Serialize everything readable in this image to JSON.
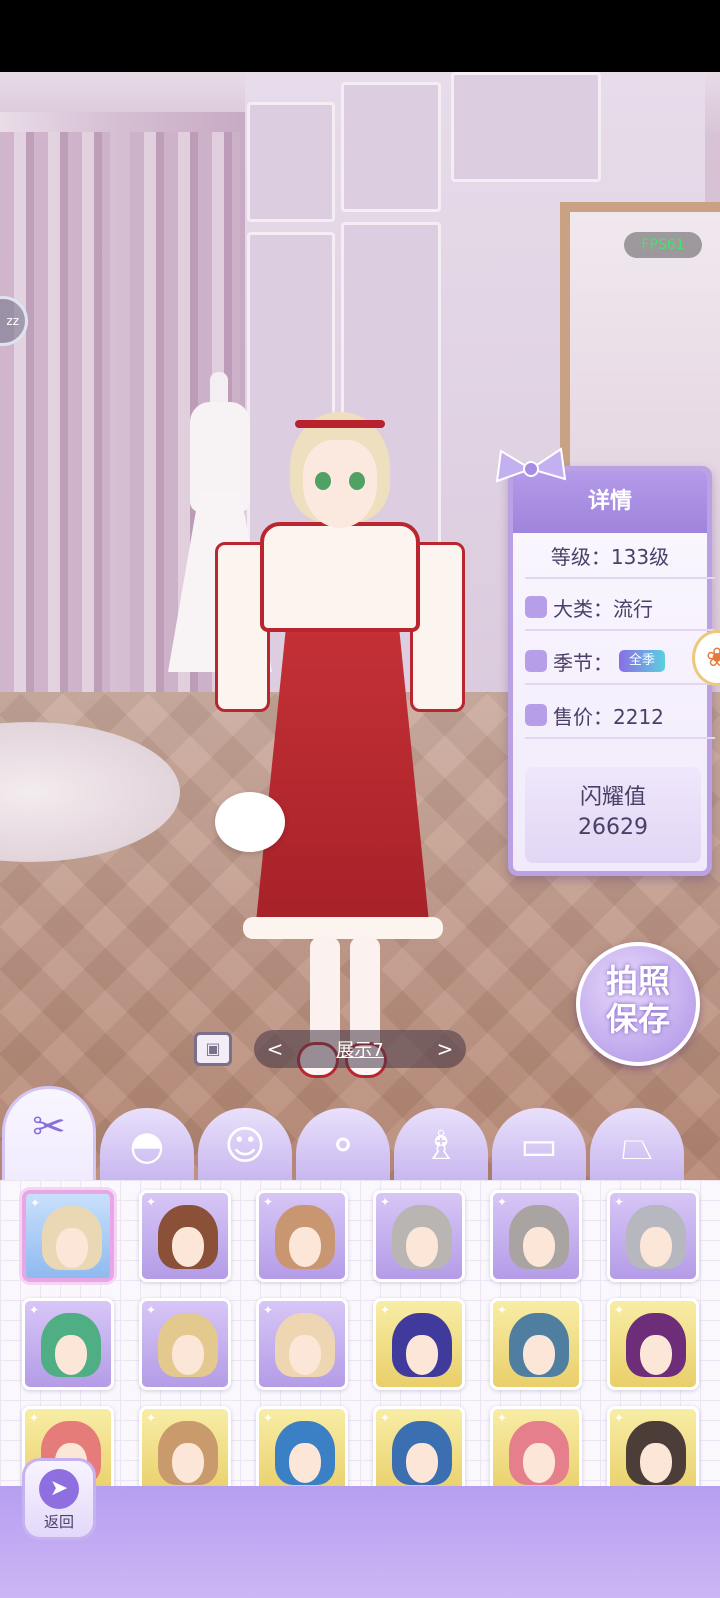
{
  "fps_label": "FPS61",
  "side_bubble": "zz",
  "detail_panel": {
    "title": "详情",
    "level": "等级：133级",
    "category": "大类：流行",
    "season_label": "季节：",
    "season_tag": "全季",
    "price": "售价：2212",
    "shine_label": "闪耀值",
    "shine_value": "26629"
  },
  "photo_button": {
    "line1": "拍照",
    "line2": "保存"
  },
  "outfit_nav": {
    "prev": "<",
    "name": "展示7",
    "next": ">"
  },
  "category_tabs": [
    {
      "icon": "scissors-icon",
      "glyph": "✂",
      "active": true
    },
    {
      "icon": "hat-icon",
      "glyph": "◓",
      "active": false
    },
    {
      "icon": "face-icon",
      "glyph": "☺",
      "active": false
    },
    {
      "icon": "earrings-icon",
      "glyph": "⚬",
      "active": false
    },
    {
      "icon": "dress-icon",
      "glyph": "♗",
      "active": false
    },
    {
      "icon": "shirt-icon",
      "glyph": "▭",
      "active": false
    },
    {
      "icon": "skirt-icon",
      "glyph": "⏢",
      "active": false
    }
  ],
  "hair_items": [
    {
      "rarity": "blue",
      "hair_color": "#ead7b4",
      "selected": true
    },
    {
      "rarity": "purple",
      "hair_color": "#8a5138",
      "selected": false
    },
    {
      "rarity": "purple",
      "hair_color": "#c99672",
      "selected": false
    },
    {
      "rarity": "purple",
      "hair_color": "#b9b5b2",
      "selected": false
    },
    {
      "rarity": "purple",
      "hair_color": "#a9a3a1",
      "selected": false
    },
    {
      "rarity": "purple",
      "hair_color": "#b7b8bf",
      "selected": false
    },
    {
      "rarity": "purple",
      "hair_color": "#4fae84",
      "selected": false
    },
    {
      "rarity": "purple",
      "hair_color": "#e4c98f",
      "selected": false
    },
    {
      "rarity": "purple",
      "hair_color": "#efd6b3",
      "selected": false
    },
    {
      "rarity": "gold",
      "hair_color": "#3f3a9c",
      "selected": false
    },
    {
      "rarity": "gold",
      "hair_color": "#4f7ea1",
      "selected": false
    },
    {
      "rarity": "gold",
      "hair_color": "#6e2d78",
      "selected": false
    },
    {
      "rarity": "gold",
      "hair_color": "#e57c7a",
      "selected": false
    },
    {
      "rarity": "gold",
      "hair_color": "#c99a6c",
      "selected": false
    },
    {
      "rarity": "gold",
      "hair_color": "#3b7fc4",
      "selected": false
    },
    {
      "rarity": "gold",
      "hair_color": "#3b6fb1",
      "selected": false
    },
    {
      "rarity": "gold",
      "hair_color": "#e67f8c",
      "selected": false
    },
    {
      "rarity": "gold",
      "hair_color": "#4d3d38",
      "selected": false
    }
  ],
  "back_button": {
    "label": "返回"
  }
}
